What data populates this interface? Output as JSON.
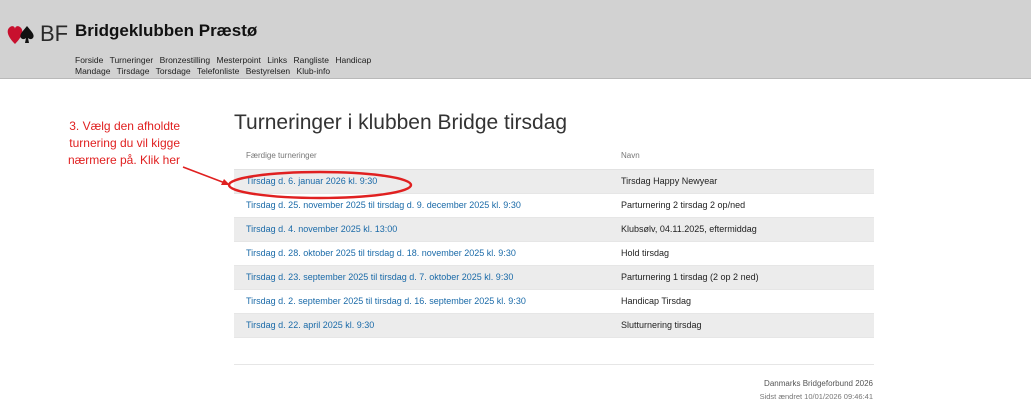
{
  "header": {
    "logo_text": "BF",
    "club_name": "Bridgeklubben Præstø",
    "nav_row1": [
      "Forside",
      "Turneringer",
      "Bronzestilling",
      "Mesterpoint",
      "Links",
      "Rangliste",
      "Handicap"
    ],
    "nav_row2": [
      "Mandage",
      "Tirsdage",
      "Torsdage",
      "Telefonliste",
      "Bestyrelsen",
      "Klub-info"
    ]
  },
  "main": {
    "title": "Turneringer i klubben Bridge tirsdag",
    "table": {
      "col1": "Færdige turneringer",
      "col2": "Navn",
      "rows": [
        {
          "link": "Tirsdag d. 6. januar 2026  kl. 9:30",
          "name": "Tirsdag Happy Newyear"
        },
        {
          "link": "Tirsdag d. 25. november 2025 til tirsdag d. 9. december 2025  kl. 9:30",
          "name": "Parturnering 2 tirsdag 2 op/ned"
        },
        {
          "link": "Tirsdag d. 4. november 2025  kl. 13:00",
          "name": "Klubsølv, 04.11.2025, eftermiddag"
        },
        {
          "link": "Tirsdag d. 28. oktober 2025 til tirsdag d. 18. november 2025  kl. 9:30",
          "name": "Hold tirsdag"
        },
        {
          "link": "Tirsdag d. 23. september 2025 til tirsdag d. 7. oktober 2025  kl. 9:30",
          "name": "Parturnering 1 tirsdag (2 op 2 ned)"
        },
        {
          "link": "Tirsdag d. 2. september 2025 til tirsdag d. 16. september 2025  kl. 9:30",
          "name": "Handicap Tirsdag"
        },
        {
          "link": "Tirsdag d. 22. april 2025  kl. 9:30",
          "name": "Slutturnering tirsdag"
        }
      ]
    }
  },
  "footer": {
    "org": "Danmarks Bridgeforbund 2026",
    "updated": "Sidst ændret 10/01/2026 09:46:41"
  },
  "annotation": {
    "lines": [
      "3. Vælg den afholdte",
      "turnering du vil kigge",
      "nærmere på. Klik her"
    ],
    "color": "#e02020"
  }
}
